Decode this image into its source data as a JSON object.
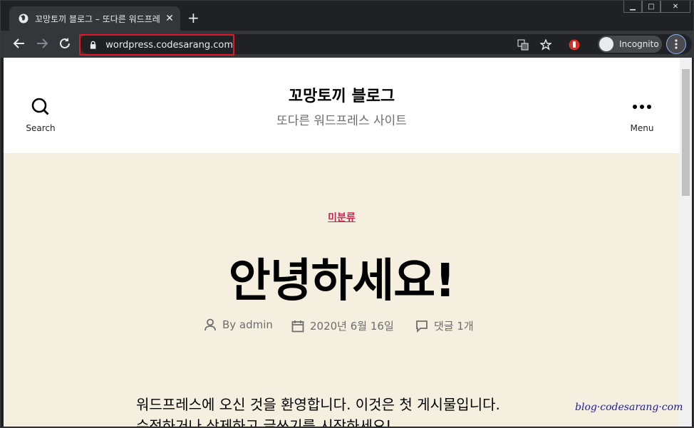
{
  "browser": {
    "tab_title": "꼬망토끼 블로그 – 또다른 워드프레스",
    "tab_close": "✕",
    "new_tab": "+",
    "url": "wordpress.codesarang.com",
    "incognito_label": "Incognito",
    "min": "▁",
    "max": "□",
    "close": "✕"
  },
  "header": {
    "site_title": "꼬망토끼 블로그",
    "site_description": "또다른 워드프레스 사이트",
    "search_label": "Search",
    "menu_label": "Menu"
  },
  "post": {
    "category": "미분류",
    "title": "안녕하세요!",
    "author": "By admin",
    "date": "2020년 6월 16일",
    "comments": "댓글 1개",
    "content_line1": "워드프레스에 오신 것을 환영합니다. 이것은 첫 게시물입니다.",
    "content_line2": "수정하거나 삭제하고 글쓰기를 시작하세요!"
  },
  "watermark": "blog·codesarang·com",
  "colors": {
    "accent": "#cd2653",
    "highlight": "#e0182a"
  }
}
